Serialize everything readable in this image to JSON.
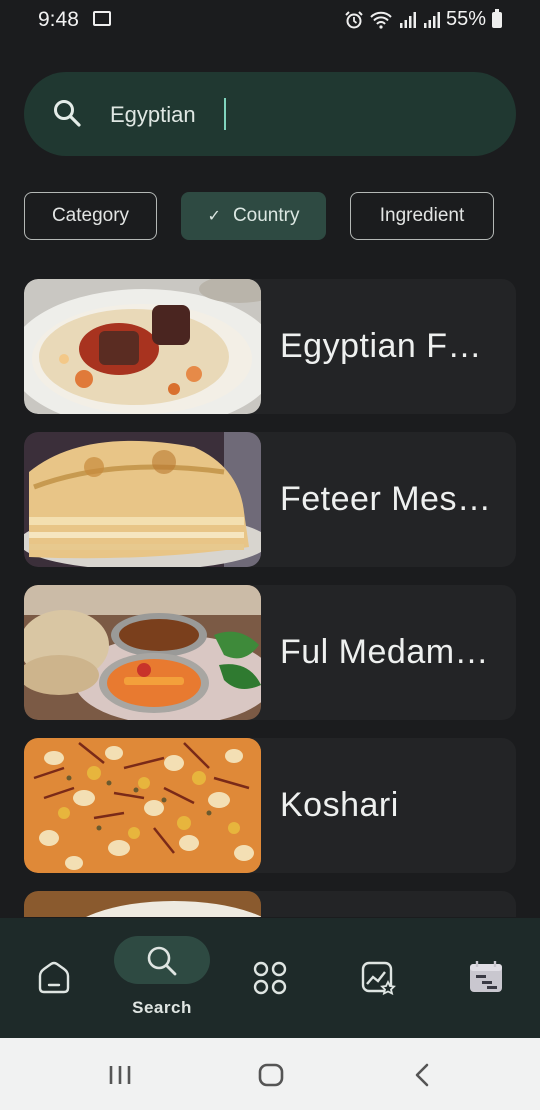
{
  "status_bar": {
    "time": "9:48",
    "battery": "55%"
  },
  "search": {
    "query": "Egyptian"
  },
  "filters": [
    {
      "label": "Category",
      "selected": false
    },
    {
      "label": "Country",
      "selected": true
    },
    {
      "label": "Ingredient",
      "selected": false
    }
  ],
  "results": [
    {
      "title": "Egyptian Fa…"
    },
    {
      "title": "Feteer Mes…"
    },
    {
      "title": "Ful Medam…"
    },
    {
      "title": "Koshari"
    }
  ],
  "bottom_nav": {
    "items": [
      {
        "icon": "home-icon"
      },
      {
        "icon": "search-icon",
        "label": "Search",
        "active": true
      },
      {
        "icon": "categories-grid-icon"
      },
      {
        "icon": "favorites-image-icon"
      },
      {
        "icon": "meal-planner-icon"
      }
    ]
  },
  "colors": {
    "background": "#1b1c1e",
    "accent": "#2e4a42",
    "search_bg": "#203831"
  }
}
